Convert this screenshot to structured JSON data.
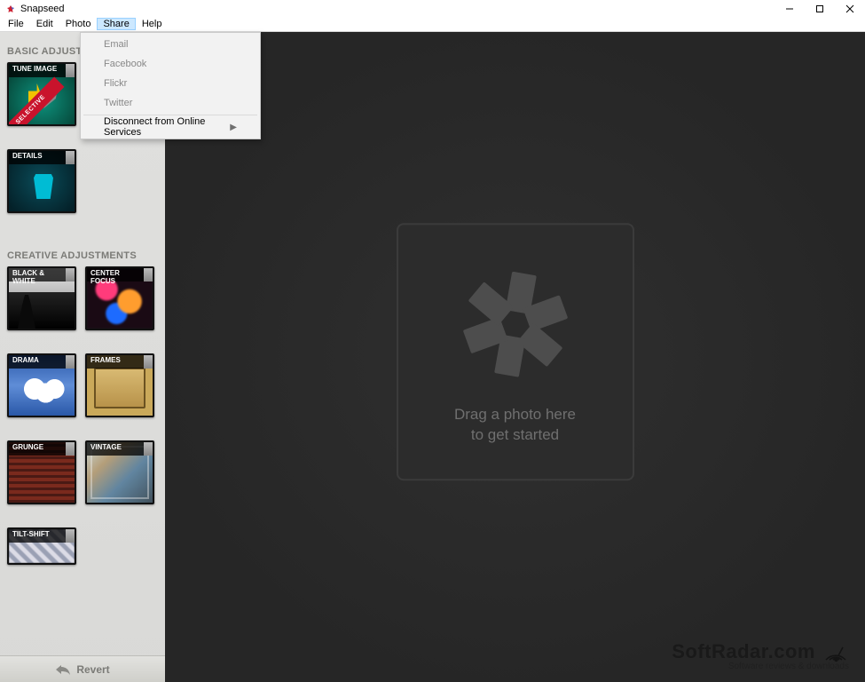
{
  "app": {
    "title": "Snapseed"
  },
  "menubar": [
    "File",
    "Edit",
    "Photo",
    "Share",
    "Help"
  ],
  "menubar_active_index": 3,
  "share_menu": {
    "items": [
      {
        "label": "Email",
        "enabled": false
      },
      {
        "label": "Facebook",
        "enabled": false
      },
      {
        "label": "Flickr",
        "enabled": false
      },
      {
        "label": "Twitter",
        "enabled": false
      }
    ],
    "disconnect": "Disconnect from Online Services"
  },
  "sidebar": {
    "basic_title": "BASIC ADJUSTMENTS",
    "creative_title": "CREATIVE ADJUSTMENTS",
    "basic": [
      {
        "label": "TUNE IMAGE",
        "art": "art-tune",
        "ribbon": "SELECTIVE"
      },
      {
        "label": "",
        "art": "art-crop"
      },
      {
        "label": "DETAILS",
        "art": "art-details"
      }
    ],
    "creative": [
      {
        "label": "BLACK &\nWHITE",
        "art": "art-bw"
      },
      {
        "label": "CENTER\nFOCUS",
        "art": "art-center"
      },
      {
        "label": "DRAMA",
        "art": "art-drama"
      },
      {
        "label": "FRAMES",
        "art": "art-frames"
      },
      {
        "label": "GRUNGE",
        "art": "art-grunge"
      },
      {
        "label": "VINTAGE",
        "art": "art-vintage"
      },
      {
        "label": "TILT-SHIFT",
        "art": "art-tilt"
      }
    ],
    "revert": "Revert"
  },
  "canvas": {
    "drop_line1": "Drag a photo here",
    "drop_line2": "to get started"
  },
  "watermark": {
    "main": "SoftRadar.com",
    "sub": "Software reviews & downloads"
  }
}
